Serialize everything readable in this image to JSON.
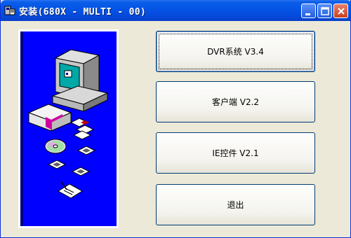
{
  "window": {
    "title": "安装(680X - MULTI - 00)"
  },
  "buttons": {
    "dvr": "DVR系统 V3.4",
    "client": "客户端 V2.2",
    "ie": "IE控件 V2.1",
    "exit": "退出"
  },
  "colors": {
    "panel_background": "#0000ff",
    "titlebar": "#0553e6",
    "window_background": "#ece9d8"
  },
  "icons": [
    "installer-app-icon",
    "minimize-icon",
    "maximize-icon",
    "close-icon",
    "computer-icon",
    "floppy-disk-icon",
    "cd-disc-icon",
    "document-icon"
  ]
}
